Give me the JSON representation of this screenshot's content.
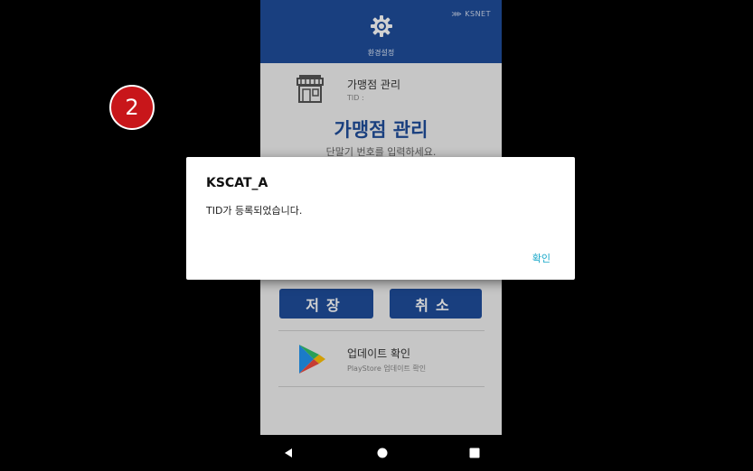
{
  "header": {
    "brand": "KSNET",
    "settings_label": "환경설정"
  },
  "store": {
    "title": "가맹점 관리",
    "tid_label": "TID :"
  },
  "main": {
    "big_title": "가맹점 관리",
    "instruction": "단말기 번호를 입력하세요."
  },
  "buttons": {
    "save_label": "저장",
    "cancel_label": "취소"
  },
  "update": {
    "title": "업데이트 확인",
    "subtitle": "PlayStore 업데이트 확인"
  },
  "step_badge": "2",
  "dialog": {
    "title": "KSCAT_A",
    "message": "TID가 등록되었습니다.",
    "ok_label": "확인"
  },
  "colors": {
    "primary": "#1f4e9c",
    "badge": "#c8161a",
    "link": "#17a7c9"
  }
}
